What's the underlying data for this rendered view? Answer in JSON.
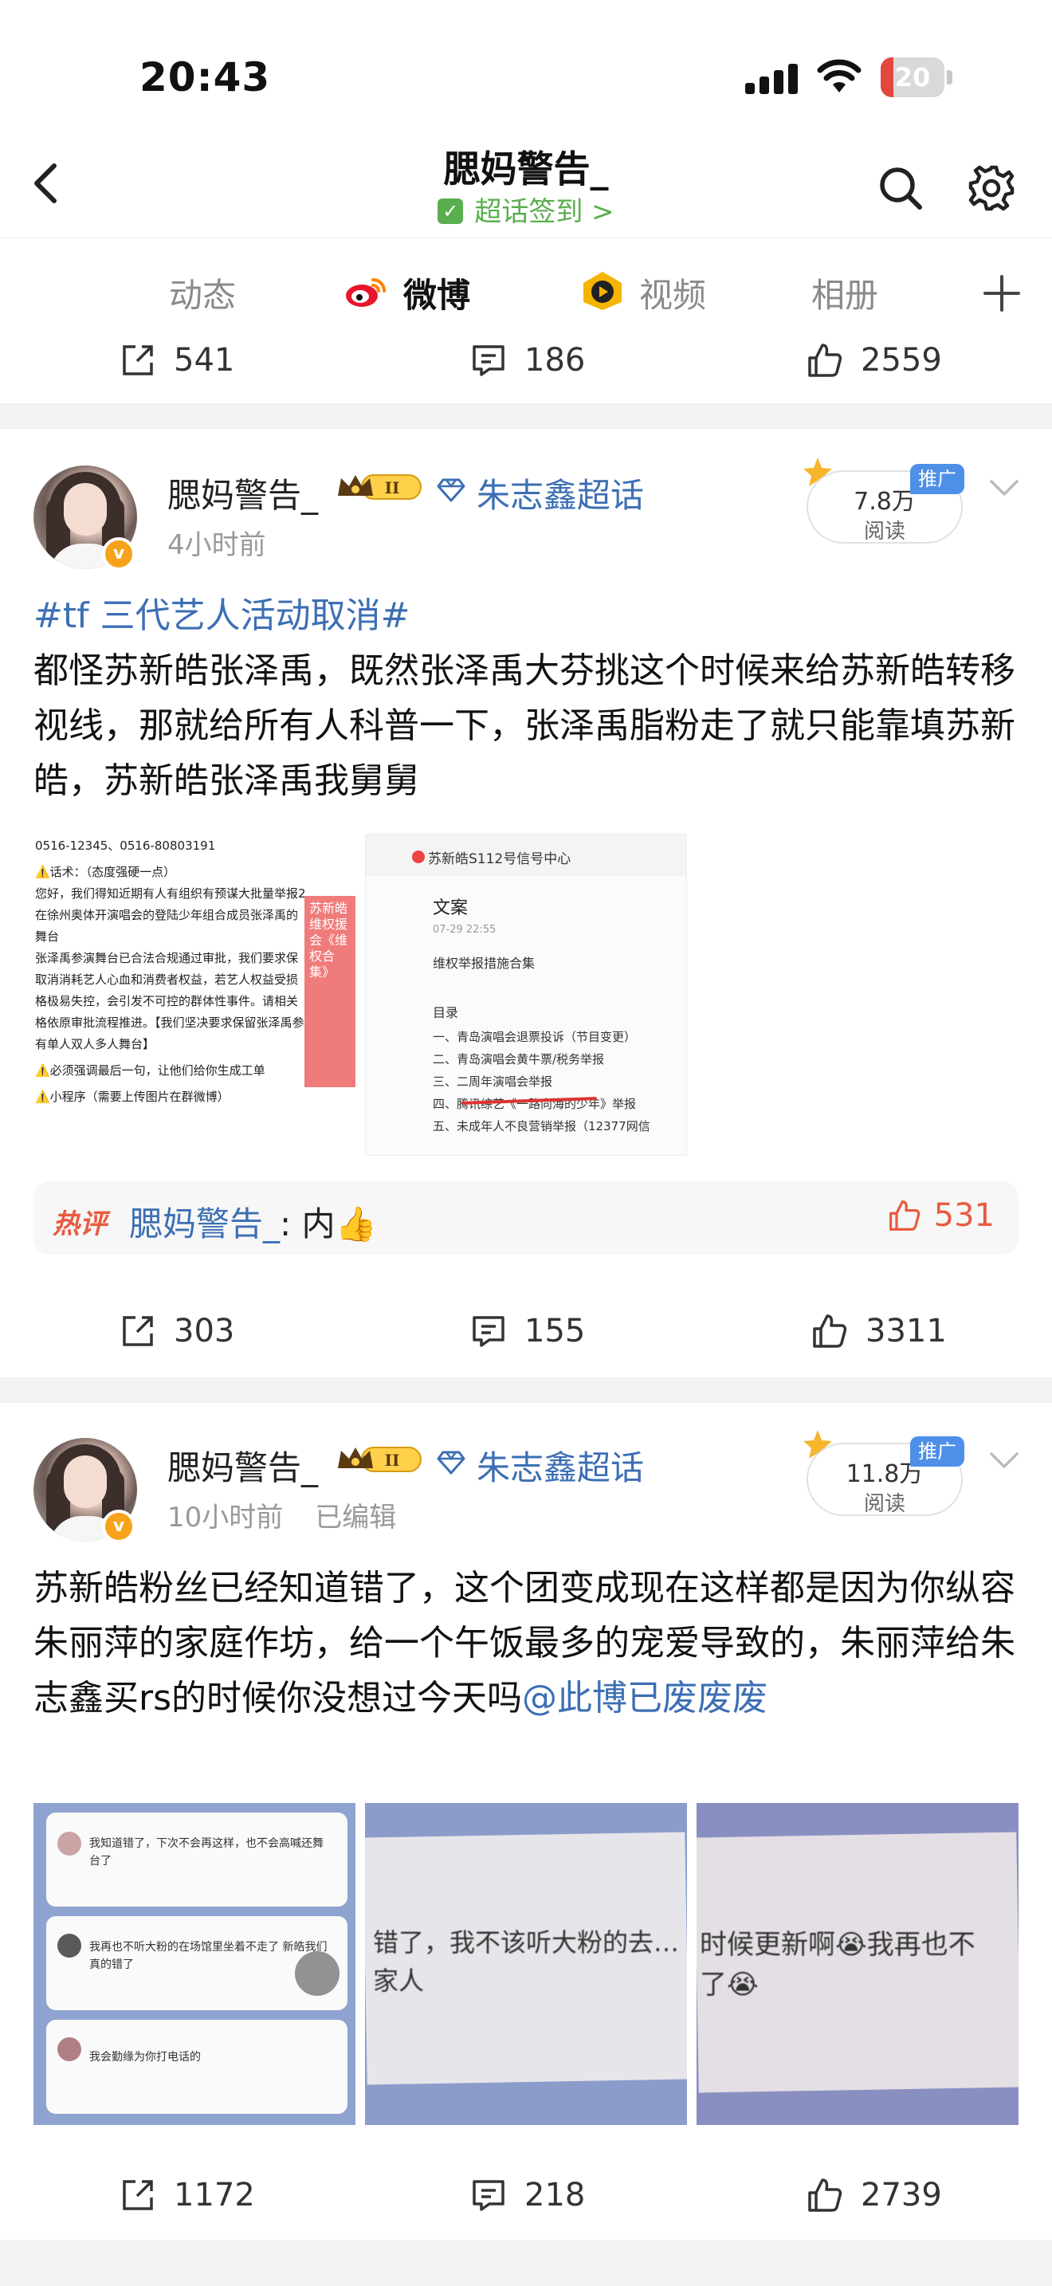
{
  "status_bar": {
    "time": "20:43",
    "battery": "20",
    "battery_fraction": 0.2
  },
  "nav": {
    "title": "腮妈警告_",
    "subtitle": "超话签到",
    "subtitle_arrow": ">"
  },
  "tabs": [
    {
      "label": "动态"
    },
    {
      "label": "微博"
    },
    {
      "label": "视频"
    },
    {
      "label": "相册"
    }
  ],
  "icons": {
    "back": "chevron-left-icon",
    "search": "search-icon",
    "settings": "gear-icon",
    "add": "plus-icon",
    "share": "share-icon",
    "comment": "comment-icon",
    "like": "thumbs-up-icon"
  },
  "colors": {
    "accent": "#ff8200",
    "link": "#3c6fb4",
    "checkin": "#5aae4e",
    "hot": "#e85b3f",
    "promo": "#4e8fe8"
  },
  "top_actions": {
    "share": "541",
    "comment": "186",
    "like": "2559"
  },
  "posts": [
    {
      "username": "腮妈警告_",
      "level": "II",
      "topic": "朱志鑫超话",
      "time": "4小时前",
      "edited": "",
      "read_count": "7.8万",
      "read_label": "阅读",
      "promo": "推广",
      "hashtag": "#tf 三代艺人活动取消#",
      "body": "都怪苏新皓张泽禹，既然张泽禹大芬挑这个时候来给苏新皓转移视线，那就给所有人科普一下，张泽禹脂粉走了就只能靠填苏新皓，苏新皓张泽禹我舅舅",
      "images": {
        "left": {
          "lines": [
            "0516-12345、0516-80803191",
            "⚠️话术：（态度强硬一点）",
            "您好，我们得知近期有人有组织有预谋大批量举报2",
            "在徐州奥体开演唱会的登陆少年组合成员张泽禹的",
            "舞台",
            "张泽禹参演舞台已合法合规通过审批，我们要求保",
            "取消消耗艺人心血和消费者权益，若艺人权益受损",
            "格极易失控，会引发不可控的群体性事件。请相关",
            "格依原审批流程推进。【我们坚决要求保留张泽禹参",
            "有单人双人多人舞台】",
            "⚠️必须强调最后一句，让他们给你生成工单",
            "⚠️小程序（需要上传图片在群微博）"
          ],
          "stamp": "苏新皓维权援会《维权合集》"
        },
        "right": {
          "header": "苏新皓S112号信号中心",
          "title": "文案",
          "date": "07-29 22:55",
          "subtitle": "维权举报措施合集",
          "toc": "目录",
          "items": [
            "一、青岛演唱会退票投诉（节目变更）",
            "二、青岛演唱会黄牛票/税务举报",
            "三、二周年演唱会举报",
            "四、腾讯综艺《一路向海的少年》举报",
            "五、未成年人不良营销举报（12377网信"
          ]
        }
      },
      "hot_comment": {
        "tag": "热评",
        "author": "腮妈警告_",
        "text": ": 内👍",
        "likes": "531"
      },
      "actions": {
        "share": "303",
        "comment": "155",
        "like": "3311"
      }
    },
    {
      "username": "腮妈警告_",
      "level": "II",
      "topic": "朱志鑫超话",
      "time": "10小时前",
      "edited": "已编辑",
      "read_count": "11.8万",
      "read_label": "阅读",
      "promo": "推广",
      "body": "苏新皓粉丝已经知道错了，这个团变成现在这样都是因为你纵容朱丽萍的家庭作坊，给一个午饭最多的宠爱导致的，朱丽萍给朱志鑫买rs的时候你没想过今天吗",
      "mention": "@此博已废废废",
      "images": {
        "a": {
          "lines": [
            "我知道错了，下次不会再这样，也不会高喊还舞台了",
            "我再也不听大粉的在场馆里坐着不走了 新皓我们真的错了",
            "我会勤缘为你打电话的"
          ]
        },
        "b": {
          "text": "错了，我不该听大粉的去…",
          "text2": "家人"
        },
        "c": {
          "text": "时候更新啊😭我再也不",
          "text2": "了😭"
        }
      },
      "actions": {
        "share": "1172",
        "comment": "218",
        "like": "2739"
      }
    }
  ]
}
